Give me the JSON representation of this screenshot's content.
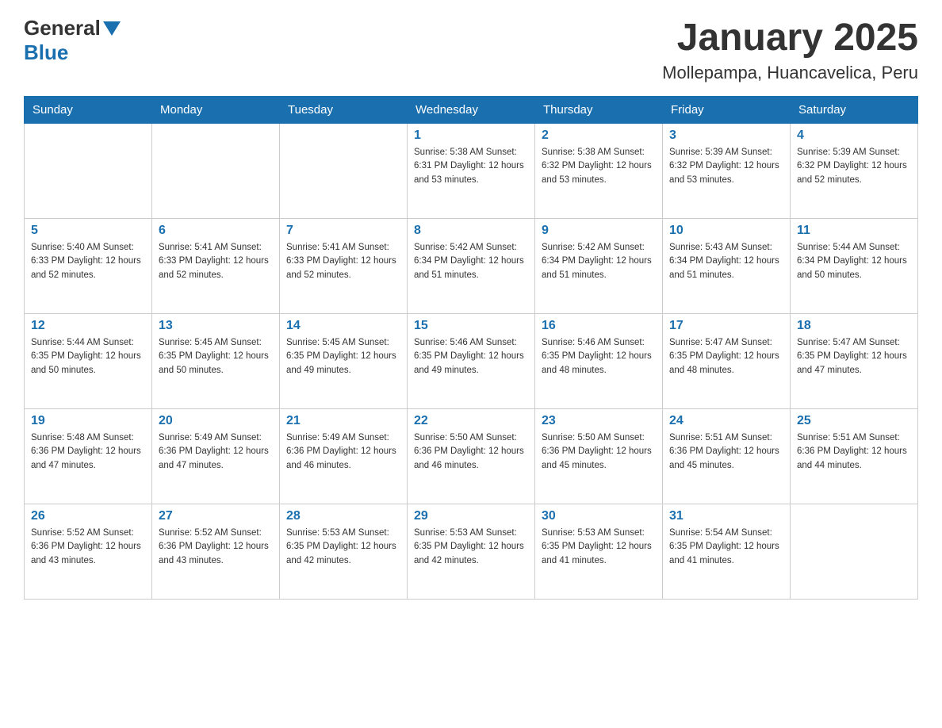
{
  "header": {
    "logo_general": "General",
    "logo_blue": "Blue",
    "title": "January 2025",
    "subtitle": "Mollepampa, Huancavelica, Peru"
  },
  "days_of_week": [
    "Sunday",
    "Monday",
    "Tuesday",
    "Wednesday",
    "Thursday",
    "Friday",
    "Saturday"
  ],
  "weeks": [
    [
      {
        "day": "",
        "info": ""
      },
      {
        "day": "",
        "info": ""
      },
      {
        "day": "",
        "info": ""
      },
      {
        "day": "1",
        "info": "Sunrise: 5:38 AM\nSunset: 6:31 PM\nDaylight: 12 hours\nand 53 minutes."
      },
      {
        "day": "2",
        "info": "Sunrise: 5:38 AM\nSunset: 6:32 PM\nDaylight: 12 hours\nand 53 minutes."
      },
      {
        "day": "3",
        "info": "Sunrise: 5:39 AM\nSunset: 6:32 PM\nDaylight: 12 hours\nand 53 minutes."
      },
      {
        "day": "4",
        "info": "Sunrise: 5:39 AM\nSunset: 6:32 PM\nDaylight: 12 hours\nand 52 minutes."
      }
    ],
    [
      {
        "day": "5",
        "info": "Sunrise: 5:40 AM\nSunset: 6:33 PM\nDaylight: 12 hours\nand 52 minutes."
      },
      {
        "day": "6",
        "info": "Sunrise: 5:41 AM\nSunset: 6:33 PM\nDaylight: 12 hours\nand 52 minutes."
      },
      {
        "day": "7",
        "info": "Sunrise: 5:41 AM\nSunset: 6:33 PM\nDaylight: 12 hours\nand 52 minutes."
      },
      {
        "day": "8",
        "info": "Sunrise: 5:42 AM\nSunset: 6:34 PM\nDaylight: 12 hours\nand 51 minutes."
      },
      {
        "day": "9",
        "info": "Sunrise: 5:42 AM\nSunset: 6:34 PM\nDaylight: 12 hours\nand 51 minutes."
      },
      {
        "day": "10",
        "info": "Sunrise: 5:43 AM\nSunset: 6:34 PM\nDaylight: 12 hours\nand 51 minutes."
      },
      {
        "day": "11",
        "info": "Sunrise: 5:44 AM\nSunset: 6:34 PM\nDaylight: 12 hours\nand 50 minutes."
      }
    ],
    [
      {
        "day": "12",
        "info": "Sunrise: 5:44 AM\nSunset: 6:35 PM\nDaylight: 12 hours\nand 50 minutes."
      },
      {
        "day": "13",
        "info": "Sunrise: 5:45 AM\nSunset: 6:35 PM\nDaylight: 12 hours\nand 50 minutes."
      },
      {
        "day": "14",
        "info": "Sunrise: 5:45 AM\nSunset: 6:35 PM\nDaylight: 12 hours\nand 49 minutes."
      },
      {
        "day": "15",
        "info": "Sunrise: 5:46 AM\nSunset: 6:35 PM\nDaylight: 12 hours\nand 49 minutes."
      },
      {
        "day": "16",
        "info": "Sunrise: 5:46 AM\nSunset: 6:35 PM\nDaylight: 12 hours\nand 48 minutes."
      },
      {
        "day": "17",
        "info": "Sunrise: 5:47 AM\nSunset: 6:35 PM\nDaylight: 12 hours\nand 48 minutes."
      },
      {
        "day": "18",
        "info": "Sunrise: 5:47 AM\nSunset: 6:35 PM\nDaylight: 12 hours\nand 47 minutes."
      }
    ],
    [
      {
        "day": "19",
        "info": "Sunrise: 5:48 AM\nSunset: 6:36 PM\nDaylight: 12 hours\nand 47 minutes."
      },
      {
        "day": "20",
        "info": "Sunrise: 5:49 AM\nSunset: 6:36 PM\nDaylight: 12 hours\nand 47 minutes."
      },
      {
        "day": "21",
        "info": "Sunrise: 5:49 AM\nSunset: 6:36 PM\nDaylight: 12 hours\nand 46 minutes."
      },
      {
        "day": "22",
        "info": "Sunrise: 5:50 AM\nSunset: 6:36 PM\nDaylight: 12 hours\nand 46 minutes."
      },
      {
        "day": "23",
        "info": "Sunrise: 5:50 AM\nSunset: 6:36 PM\nDaylight: 12 hours\nand 45 minutes."
      },
      {
        "day": "24",
        "info": "Sunrise: 5:51 AM\nSunset: 6:36 PM\nDaylight: 12 hours\nand 45 minutes."
      },
      {
        "day": "25",
        "info": "Sunrise: 5:51 AM\nSunset: 6:36 PM\nDaylight: 12 hours\nand 44 minutes."
      }
    ],
    [
      {
        "day": "26",
        "info": "Sunrise: 5:52 AM\nSunset: 6:36 PM\nDaylight: 12 hours\nand 43 minutes."
      },
      {
        "day": "27",
        "info": "Sunrise: 5:52 AM\nSunset: 6:36 PM\nDaylight: 12 hours\nand 43 minutes."
      },
      {
        "day": "28",
        "info": "Sunrise: 5:53 AM\nSunset: 6:35 PM\nDaylight: 12 hours\nand 42 minutes."
      },
      {
        "day": "29",
        "info": "Sunrise: 5:53 AM\nSunset: 6:35 PM\nDaylight: 12 hours\nand 42 minutes."
      },
      {
        "day": "30",
        "info": "Sunrise: 5:53 AM\nSunset: 6:35 PM\nDaylight: 12 hours\nand 41 minutes."
      },
      {
        "day": "31",
        "info": "Sunrise: 5:54 AM\nSunset: 6:35 PM\nDaylight: 12 hours\nand 41 minutes."
      },
      {
        "day": "",
        "info": ""
      }
    ]
  ]
}
